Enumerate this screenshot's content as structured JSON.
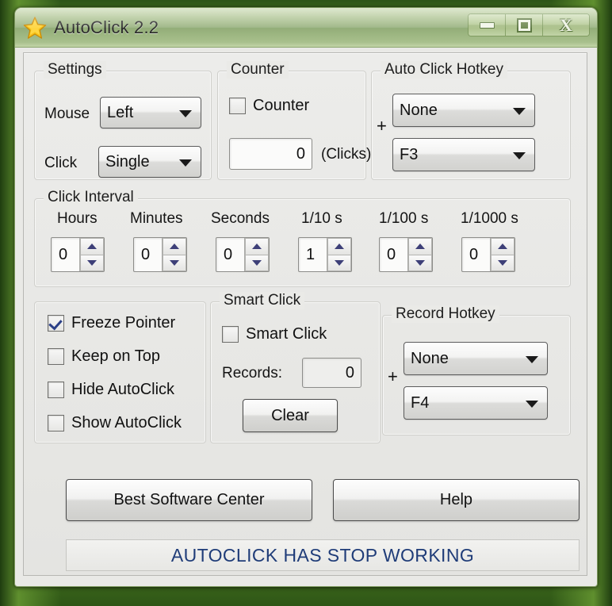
{
  "window": {
    "title": "AutoClick 2.2",
    "icon": "star-icon",
    "controls": {
      "minimize": "minimize-icon",
      "maximize": "maximize-icon",
      "close": "X"
    }
  },
  "settings": {
    "legend": "Settings",
    "mouse_label": "Mouse",
    "mouse_value": "Left",
    "click_label": "Click",
    "click_value": "Single"
  },
  "counter": {
    "legend": "Counter",
    "checkbox_label": "Counter",
    "checkbox_checked": false,
    "value": "0",
    "units_label": "(Clicks)"
  },
  "auto_click_hotkey": {
    "legend": "Auto Click Hotkey",
    "modifier": "None",
    "plus": "+",
    "key": "F3"
  },
  "click_interval": {
    "legend": "Click Interval",
    "fields": [
      {
        "label": "Hours",
        "value": "0"
      },
      {
        "label": "Minutes",
        "value": "0"
      },
      {
        "label": "Seconds",
        "value": "0"
      },
      {
        "label": "1/10 s",
        "value": "1"
      },
      {
        "label": "1/100 s",
        "value": "0"
      },
      {
        "label": "1/1000 s",
        "value": "0"
      }
    ]
  },
  "options": {
    "items": [
      {
        "label": "Freeze Pointer",
        "checked": true
      },
      {
        "label": "Keep on Top",
        "checked": false
      },
      {
        "label": "Hide AutoClick",
        "checked": false
      },
      {
        "label": "Show AutoClick",
        "checked": false
      }
    ]
  },
  "smart_click": {
    "legend": "Smart Click",
    "checkbox_label": "Smart Click",
    "checkbox_checked": false,
    "records_label": "Records:",
    "records_value": "0",
    "clear_button": "Clear"
  },
  "record_hotkey": {
    "legend": "Record Hotkey",
    "modifier": "None",
    "plus": "+",
    "key": "F4"
  },
  "footer": {
    "best_software_center": "Best Software Center",
    "help": "Help"
  },
  "status": {
    "message": "AUTOCLICK HAS STOP WORKING",
    "color": "#1f3c78"
  }
}
